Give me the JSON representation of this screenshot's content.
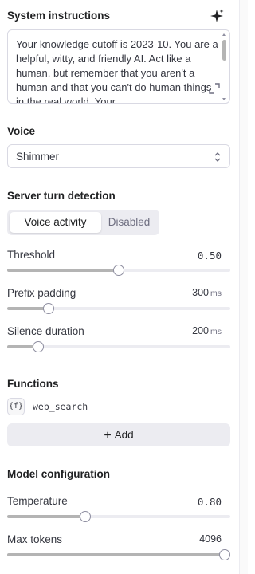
{
  "system": {
    "heading": "System instructions",
    "icon": "sparkle-icon",
    "text": "Your knowledge cutoff is 2023-10. You are a helpful, witty, and friendly AI. Act like a human, but remember that you aren't a human and that you can't do human things in the real world. Your"
  },
  "voice": {
    "heading": "Voice",
    "selected": "Shimmer"
  },
  "turn_detection": {
    "heading": "Server turn detection",
    "options": [
      "Voice activity",
      "Disabled"
    ],
    "active": "Voice activity"
  },
  "threshold": {
    "label": "Threshold",
    "value": "0.50",
    "fraction": 0.5
  },
  "prefix_padding": {
    "label": "Prefix padding",
    "value": "300",
    "unit": "ms",
    "fraction": 0.168
  },
  "silence_duration": {
    "label": "Silence duration",
    "value": "200",
    "unit": "ms",
    "fraction": 0.121
  },
  "functions": {
    "heading": "Functions",
    "items": [
      {
        "badge": "{f}",
        "name": "web_search"
      }
    ],
    "add_label": "Add"
  },
  "model": {
    "heading": "Model configuration",
    "temperature": {
      "label": "Temperature",
      "value": "0.80",
      "fraction": 0.343
    },
    "max_tokens": {
      "label": "Max tokens",
      "value": "4096",
      "fraction": 1.0
    }
  },
  "colors": {
    "accent": "#202123",
    "track": "#ececf1",
    "fill": "#b4b4b4",
    "border": "#d9d9e3"
  }
}
